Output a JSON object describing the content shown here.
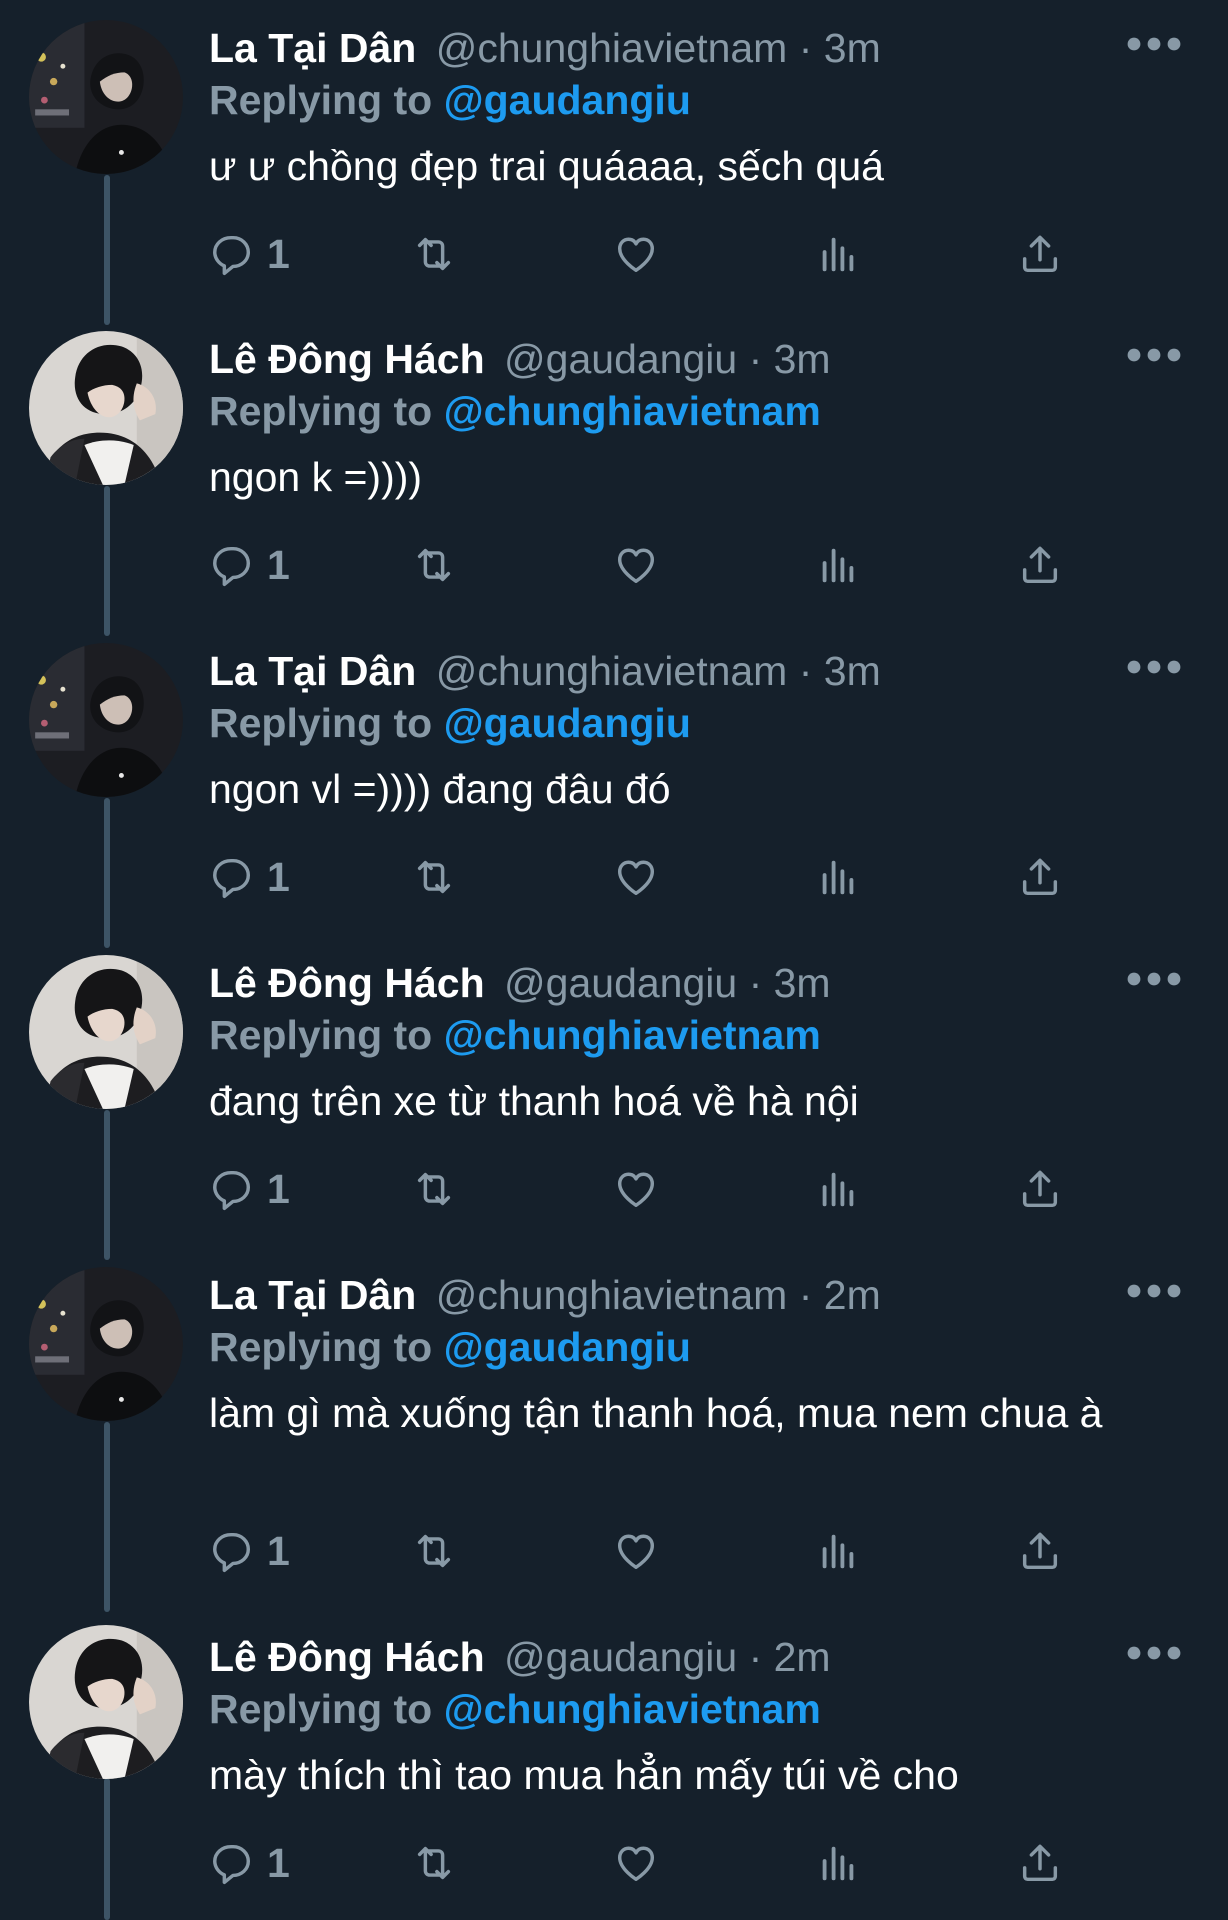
{
  "tweets": [
    {
      "name": "La Tại Dân",
      "handle_time": "@chunghiavietnam · 3m",
      "reply_prefix": "Replying to",
      "reply_handle": "@gaudangiu",
      "text": "ư ư chồng đẹp trai quáaaa, sếch quá",
      "reply_count": "1"
    },
    {
      "name": "Lê Đông Hách",
      "handle_time": "@gaudangiu · 3m",
      "reply_prefix": "Replying to",
      "reply_handle": "@chunghiavietnam",
      "text": "ngon k =))))",
      "reply_count": "1"
    },
    {
      "name": "La Tại Dân",
      "handle_time": "@chunghiavietnam · 3m",
      "reply_prefix": "Replying to",
      "reply_handle": "@gaudangiu",
      "text": "ngon vl =)))) đang đâu đó",
      "reply_count": "1"
    },
    {
      "name": "Lê Đông Hách",
      "handle_time": "@gaudangiu · 3m",
      "reply_prefix": "Replying to",
      "reply_handle": "@chunghiavietnam",
      "text": "đang trên xe từ thanh hoá về hà nội",
      "reply_count": "1"
    },
    {
      "name": "La Tại Dân",
      "handle_time": "@chunghiavietnam · 2m",
      "reply_prefix": "Replying to",
      "reply_handle": "@gaudangiu",
      "text": "làm gì mà xuống tận thanh hoá, mua nem chua à",
      "reply_count": "1"
    },
    {
      "name": "Lê Đông Hách",
      "handle_time": "@gaudangiu · 2m",
      "reply_prefix": "Replying to",
      "reply_handle": "@chunghiavietnam",
      "text": "mày thích thì tao mua hẳn mấy túi về cho",
      "reply_count": "1"
    }
  ],
  "icons": {
    "reply": "reply-icon",
    "retweet": "retweet-icon",
    "like": "heart-icon",
    "views": "analytics-icon",
    "share": "share-icon",
    "more": "more-icon"
  },
  "colors": {
    "background": "#15202b",
    "text": "#ffffff",
    "secondary": "#8899a6",
    "link": "#1d9bf0",
    "thread_line": "#3d5466"
  }
}
